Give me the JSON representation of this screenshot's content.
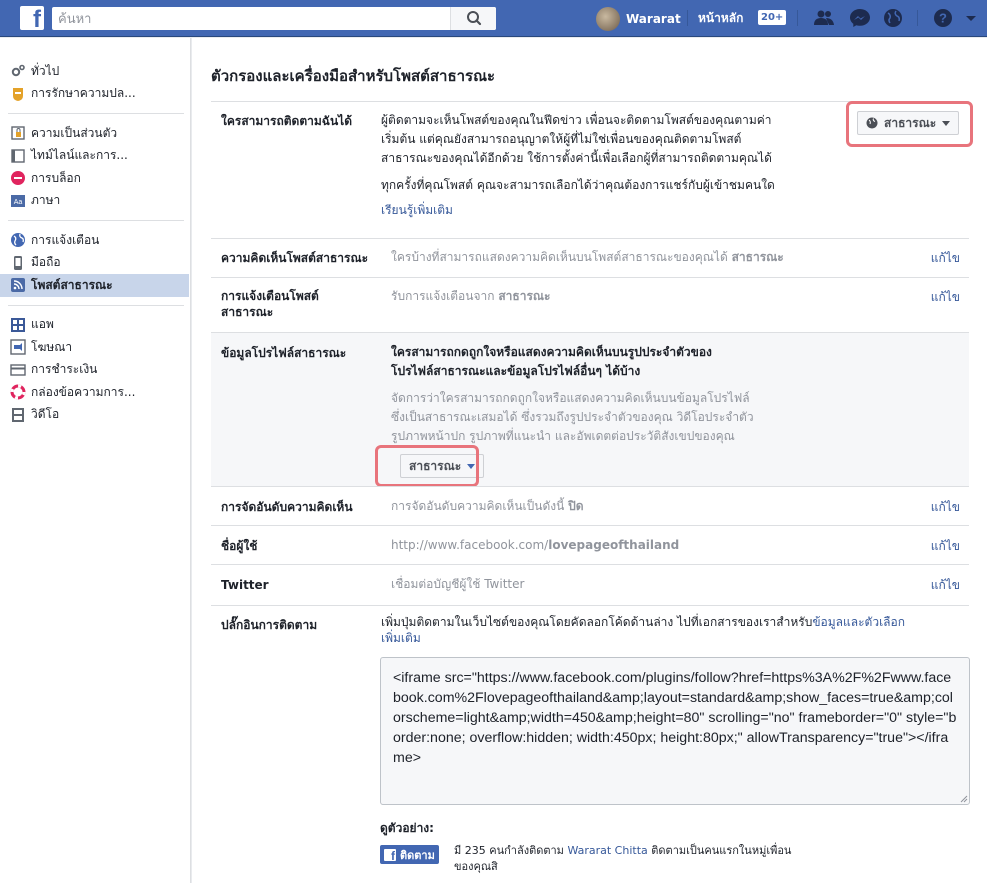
{
  "topbar": {
    "search_placeholder": "ค้นหา",
    "user_name": "Wararat",
    "home_label": "หน้าหลัก",
    "home_badge": "20+",
    "brand_color": "#4267b2"
  },
  "sidebar": {
    "groups": [
      [
        {
          "label": "ทั่วไป",
          "icon": "gears-icon"
        },
        {
          "label": "การรักษาความปล...",
          "icon": "badge-icon"
        }
      ],
      [
        {
          "label": "ความเป็นส่วนตัว",
          "icon": "lock-icon"
        },
        {
          "label": "ไทม์ไลน์และการ...",
          "icon": "timeline-icon"
        },
        {
          "label": "การบล็อก",
          "icon": "block-icon"
        },
        {
          "label": "ภาษา",
          "icon": "language-icon"
        }
      ],
      [
        {
          "label": "การแจ้งเตือน",
          "icon": "globe-icon"
        },
        {
          "label": "มือถือ",
          "icon": "mobile-icon"
        },
        {
          "label": "โพสต์สาธารณะ",
          "icon": "rss-icon",
          "active": true
        }
      ],
      [
        {
          "label": "แอพ",
          "icon": "apps-icon"
        },
        {
          "label": "โฆษณา",
          "icon": "ads-icon"
        },
        {
          "label": "การชำระเงิน",
          "icon": "payment-icon"
        },
        {
          "label": "กล่องข้อความการ...",
          "icon": "lifebuoy-icon"
        },
        {
          "label": "วิดีโอ",
          "icon": "film-icon"
        }
      ]
    ]
  },
  "main": {
    "title": "ตัวกรองและเครื่องมือสำหรับโพสต์สาธารณะ",
    "edit_label": "แก้ไข",
    "follow": {
      "label": "ใครสามารถติดตามฉันได้",
      "line1": "ผู้ติดตามจะเห็นโพสต์ของคุณในฟีดข่าว เพื่อนจะติดตามโพสต์ของคุณตามค่า",
      "line2": "เริ่มต้น แต่คุณยังสามารถอนุญาตให้ผู้ที่ไม่ใช่เพื่อนของคุณติดตามโพสต์",
      "line3": "สาธารณะของคุณได้อีกด้วย ใช้การตั้งค่านี้เพื่อเลือกผู้ที่สามารถติดตามคุณได้",
      "line4": "ทุกครั้งที่คุณโพสต์ คุณจะสามารถเลือกได้ว่าคุณต้องการแชร์กับผู้เข้าชมคนใด",
      "learn_more": "เรียนรู้เพิ่มเติม",
      "audience": "สาธารณะ"
    },
    "comments": {
      "label": "ความคิดเห็นโพสต์สาธารณะ",
      "text": "ใครบ้างที่สามารถแสดงความคิดเห็นบนโพสต์สาธารณะของคุณได้",
      "value": "สาธารณะ"
    },
    "notifications": {
      "label": "การแจ้งเตือนโพสต์สาธารณะ",
      "text": "รับการแจ้งเตือนจาก",
      "value": "สาธารณะ"
    },
    "profile_info": {
      "label": "ข้อมูลโปรไฟล์สาธารณะ",
      "heading1": "ใครสามารถกดถูกใจหรือแสดงความคิดเห็นบนรูปประจำตัวของ",
      "heading2": "โปรไฟล์สาธารณะและข้อมูลโปรไฟล์อื่นๆ ได้บ้าง",
      "desc1": "จัดการว่าใครสามารถกดถูกใจหรือแสดงความคิดเห็นบนข้อมูลโปรไฟล์",
      "desc2": "ซึ่งเป็นสาธารณะเสมอได้ ซึ่งรวมถึงรูปประจำตัวของคุณ วิดีโอประจำตัว",
      "desc3": "รูปภาพหน้าปก รูปภาพที่แนะนำ และอัพเดตต่อประวัติสังเขปของคุณ",
      "audience": "สาธารณะ"
    },
    "ranking": {
      "label": "การจัดอันดับความคิดเห็น",
      "text": "การจัดอันดับความคิดเห็นเป็นดังนี้",
      "value": "ปิด"
    },
    "username": {
      "label": "ชื่อผู้ใช้",
      "url_prefix": "http://www.facebook.com/",
      "url_name": "lovepageofthailand"
    },
    "twitter": {
      "label": "Twitter",
      "text": "เชื่อมต่อบัญชีผู้ใช้ Twitter"
    },
    "plugin": {
      "label": "ปลั๊กอินการติดตาม",
      "intro": "เพิ่มปุ่มติดตามในเว็บไซต์ของคุณโดยคัดลอกโค้ดด้านล่าง ไปที่เอกสารของเราสำหรับ",
      "link1": "ข้อมูลและตัวเลือก",
      "link2": "เพิ่มเติม",
      "code": "<iframe src=\"https://www.facebook.com/plugins/follow?href=https%3A%2F%2Fwww.facebook.com%2Flovepageofthailand&amp;layout=standard&amp;show_faces=true&amp;colorscheme=light&amp;width=450&amp;height=80\" scrolling=\"no\" frameborder=\"0\" style=\"border:none; overflow:hidden; width:450px; height:80px;\" allowTransparency=\"true\"></iframe>",
      "example_label": "ดูตัวอย่าง:",
      "follow_btn": "ติดตาม",
      "example_pre": "มี 235 คนกำลังติดตาม",
      "example_name": "Wararat Chitta",
      "example_post": "ติดตามเป็นคนแรกในหมู่เพื่อน",
      "example_line2": "ของคุณสิ"
    }
  }
}
